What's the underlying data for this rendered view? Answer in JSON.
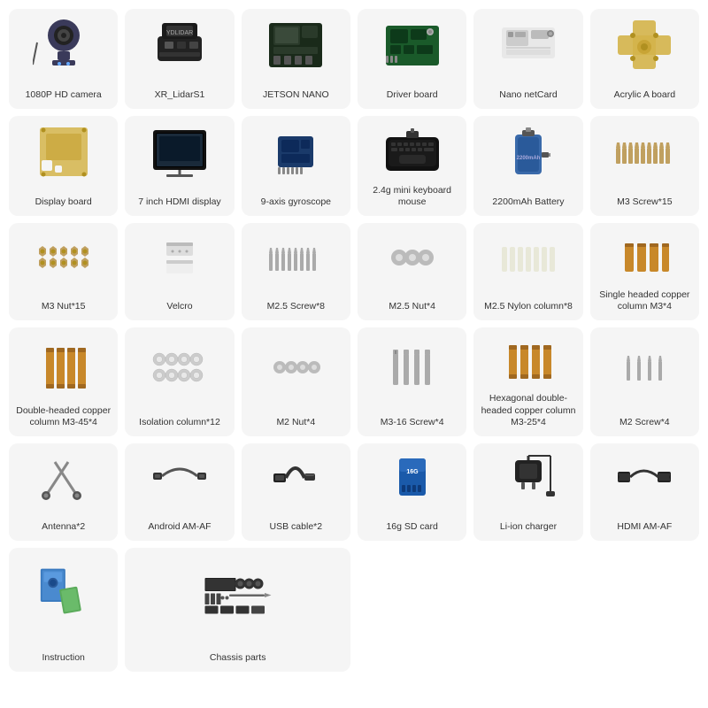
{
  "items": [
    {
      "id": "hd-camera",
      "label": "1080P HD camera",
      "icon": "camera"
    },
    {
      "id": "xr-lidar",
      "label": "XR_LidarS1",
      "icon": "lidar"
    },
    {
      "id": "jetson-nano",
      "label": "JETSON NANO",
      "icon": "jetson"
    },
    {
      "id": "driver-board",
      "label": "Driver board",
      "icon": "driverboard"
    },
    {
      "id": "nano-netcard",
      "label": "Nano netCard",
      "icon": "netcard"
    },
    {
      "id": "acrylic-a-board",
      "label": "Acrylic A board",
      "icon": "acrylicboard"
    },
    {
      "id": "display-board",
      "label": "Display board",
      "icon": "displayboard"
    },
    {
      "id": "hdmi-display",
      "label": "7 inch HDMI display",
      "icon": "hdmidisplay"
    },
    {
      "id": "gyroscope",
      "label": "9-axis gyroscope",
      "icon": "gyroscope"
    },
    {
      "id": "keyboard-mouse",
      "label": "2.4g mini keyboard mouse",
      "icon": "keyboard"
    },
    {
      "id": "battery",
      "label": "2200mAh Battery",
      "icon": "battery"
    },
    {
      "id": "m3-screw15",
      "label": "M3 Screw*15",
      "icon": "screws"
    },
    {
      "id": "m3-nut15",
      "label": "M3 Nut*15",
      "icon": "nuts"
    },
    {
      "id": "velcro",
      "label": "Velcro",
      "icon": "velcro"
    },
    {
      "id": "m25-screw8",
      "label": "M2.5 Screw*8",
      "icon": "screws2"
    },
    {
      "id": "m25-nut4",
      "label": "M2.5 Nut*4",
      "icon": "smallnuts"
    },
    {
      "id": "m25-nylon8",
      "label": "M2.5 Nylon column*8",
      "icon": "nylon"
    },
    {
      "id": "single-copper",
      "label": "Single headed copper column M3*4",
      "icon": "coppercolumn"
    },
    {
      "id": "double-copper",
      "label": "Double-headed copper column M3-45*4",
      "icon": "doublecopper"
    },
    {
      "id": "isolation-col",
      "label": "Isolation column*12",
      "icon": "isolationcol"
    },
    {
      "id": "m2-nut4",
      "label": "M2 Nut*4",
      "icon": "m2nut"
    },
    {
      "id": "m3-16-screw4",
      "label": "M3-16 Screw*4",
      "icon": "longscrew"
    },
    {
      "id": "hex-double-copper",
      "label": "Hexagonal double-headed copper column  M3-25*4",
      "icon": "hexcopper"
    },
    {
      "id": "m2-screw4",
      "label": "M2 Screw*4",
      "icon": "m2screw"
    },
    {
      "id": "antenna2",
      "label": "Antenna*2",
      "icon": "antenna"
    },
    {
      "id": "android-am-af",
      "label": "Android AM-AF",
      "icon": "usbcable"
    },
    {
      "id": "usb-cable2",
      "label": "USB cable*2",
      "icon": "usbcable2"
    },
    {
      "id": "sd-card",
      "label": "16g SD card",
      "icon": "sdcard"
    },
    {
      "id": "li-ion-charger",
      "label": "Li-ion charger",
      "icon": "charger"
    },
    {
      "id": "hdmi-am-af",
      "label": "HDMI AM-AF",
      "icon": "hdmicable"
    },
    {
      "id": "instruction",
      "label": "Instruction",
      "icon": "instruction"
    },
    {
      "id": "chassis-parts",
      "label": "Chassis parts",
      "icon": "chassis"
    }
  ]
}
